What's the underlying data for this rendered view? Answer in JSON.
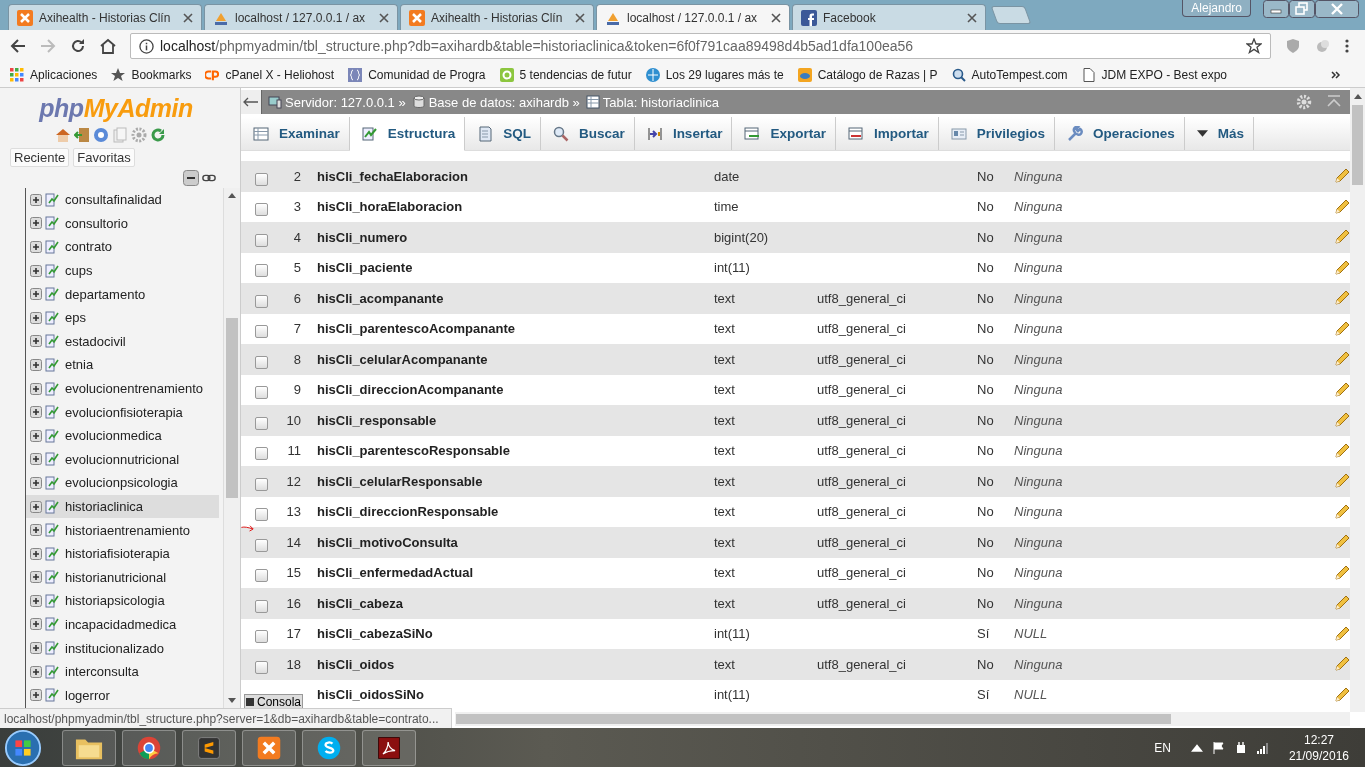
{
  "browser": {
    "tabs": [
      {
        "title": "Axihealth - Historias Clín",
        "kind": "xampp",
        "selected": false
      },
      {
        "title": "localhost / 127.0.0.1 / ax",
        "kind": "pma",
        "selected": false
      },
      {
        "title": "Axihealth - Historias Clín",
        "kind": "xampp",
        "selected": false
      },
      {
        "title": "localhost / 127.0.0.1 / ax",
        "kind": "pma",
        "selected": true
      },
      {
        "title": "Facebook",
        "kind": "facebook",
        "selected": false
      }
    ],
    "profile": "Alejandro",
    "address": {
      "host": "localhost",
      "path": "/phpmyadmin/tbl_structure.php?db=axihardb&table=historiaclinica&token=6f0f791caa89498d4b5ad1dfa100ea56"
    },
    "bookmarks": [
      {
        "label": "Aplicaciones",
        "kind": "apps"
      },
      {
        "label": "Bookmarks",
        "kind": "star"
      },
      {
        "label": "cPanel X - Heliohost",
        "kind": "cpanel"
      },
      {
        "label": "Comunidad de Progra",
        "kind": "braces"
      },
      {
        "label": "5 tendencias de futur",
        "kind": "green"
      },
      {
        "label": "Los 29 lugares más te",
        "kind": "globe"
      },
      {
        "label": "Catálogo de Razas | P",
        "kind": "orange"
      },
      {
        "label": "AutoTempest.com",
        "kind": "search"
      },
      {
        "label": "JDM EXPO - Best expo",
        "kind": "page"
      }
    ]
  },
  "sidebar": {
    "logo": {
      "prefix": "php",
      "name": "MyAdmin"
    },
    "buttons": [
      "Reciente",
      "Favoritas"
    ],
    "tables": [
      {
        "name": "consultafinalidad",
        "selected": false
      },
      {
        "name": "consultorio",
        "selected": false
      },
      {
        "name": "contrato",
        "selected": false
      },
      {
        "name": "cups",
        "selected": false
      },
      {
        "name": "departamento",
        "selected": false
      },
      {
        "name": "eps",
        "selected": false
      },
      {
        "name": "estadocivil",
        "selected": false
      },
      {
        "name": "etnia",
        "selected": false
      },
      {
        "name": "evolucionentrenamiento",
        "selected": false
      },
      {
        "name": "evolucionfisioterapia",
        "selected": false
      },
      {
        "name": "evolucionmedica",
        "selected": false
      },
      {
        "name": "evolucionnutricional",
        "selected": false
      },
      {
        "name": "evolucionpsicologia",
        "selected": false
      },
      {
        "name": "historiaclinica",
        "selected": true
      },
      {
        "name": "historiaentrenamiento",
        "selected": false
      },
      {
        "name": "historiafisioterapia",
        "selected": false
      },
      {
        "name": "historianutricional",
        "selected": false
      },
      {
        "name": "historiapsicologia",
        "selected": false
      },
      {
        "name": "incapacidadmedica",
        "selected": false
      },
      {
        "name": "institucionalizado",
        "selected": false
      },
      {
        "name": "interconsulta",
        "selected": false
      },
      {
        "name": "logerror",
        "selected": false
      }
    ]
  },
  "breadcrumb": [
    {
      "label": "Servidor: 127.0.0.1 »",
      "kind": "server"
    },
    {
      "label": "Base de datos: axihardb »",
      "kind": "database"
    },
    {
      "label": "Tabla: historiaclinica",
      "kind": "table"
    }
  ],
  "tabs": [
    {
      "label": "Examinar",
      "kind": "browse",
      "selected": false
    },
    {
      "label": "Estructura",
      "kind": "structure",
      "selected": true
    },
    {
      "label": "SQL",
      "kind": "sql",
      "selected": false
    },
    {
      "label": "Buscar",
      "kind": "search",
      "selected": false
    },
    {
      "label": "Insertar",
      "kind": "insert",
      "selected": false
    },
    {
      "label": "Exportar",
      "kind": "export",
      "selected": false
    },
    {
      "label": "Importar",
      "kind": "import",
      "selected": false
    },
    {
      "label": "Privilegios",
      "kind": "privileges",
      "selected": false
    },
    {
      "label": "Operaciones",
      "kind": "operations",
      "selected": false
    },
    {
      "label": "Más",
      "kind": "more",
      "selected": false
    }
  ],
  "structure_rows": [
    {
      "checked": false,
      "number": "2",
      "name": "hisCli_fechaElaboracion",
      "type": "date",
      "null": "No",
      "default": "Ninguna"
    },
    {
      "checked": false,
      "number": "3",
      "name": "hisCli_horaElaboracion",
      "type": "time",
      "null": "No",
      "default": "Ninguna"
    },
    {
      "checked": false,
      "number": "4",
      "name": "hisCli_numero",
      "type": "bigint(20)",
      "null": "No",
      "default": "Ninguna"
    },
    {
      "checked": false,
      "number": "5",
      "name": "hisCli_paciente",
      "type": "int(11)",
      "null": "No",
      "default": "Ninguna"
    },
    {
      "checked": false,
      "number": "6",
      "name": "hisCli_acompanante",
      "type": "text",
      "collation": "utf8_general_ci",
      "null": "No",
      "default": "Ninguna"
    },
    {
      "checked": false,
      "number": "7",
      "name": "hisCli_parentescoAcompanante",
      "type": "text",
      "collation": "utf8_general_ci",
      "null": "No",
      "default": "Ninguna"
    },
    {
      "checked": false,
      "number": "8",
      "name": "hisCli_celularAcompanante",
      "type": "text",
      "collation": "utf8_general_ci",
      "null": "No",
      "default": "Ninguna"
    },
    {
      "checked": false,
      "number": "9",
      "name": "hisCli_direccionAcompanante",
      "type": "text",
      "collation": "utf8_general_ci",
      "null": "No",
      "default": "Ninguna"
    },
    {
      "checked": false,
      "number": "10",
      "name": "hisCli_responsable",
      "type": "text",
      "collation": "utf8_general_ci",
      "null": "No",
      "default": "Ninguna"
    },
    {
      "checked": false,
      "number": "11",
      "name": "hisCli_parentescoResponsable",
      "type": "text",
      "collation": "utf8_general_ci",
      "null": "No",
      "default": "Ninguna"
    },
    {
      "checked": false,
      "number": "12",
      "name": "hisCli_celularResponsable",
      "type": "text",
      "collation": "utf8_general_ci",
      "null": "No",
      "default": "Ninguna"
    },
    {
      "checked": false,
      "number": "13",
      "name": "hisCli_direccionResponsable",
      "type": "text",
      "collation": "utf8_general_ci",
      "null": "No",
      "default": "Ninguna"
    },
    {
      "checked": false,
      "number": "14",
      "name": "hisCli_motivoConsulta",
      "type": "text",
      "collation": "utf8_general_ci",
      "null": "No",
      "default": "Ninguna"
    },
    {
      "checked": false,
      "number": "15",
      "name": "hisCli_enfermedadActual",
      "type": "text",
      "collation": "utf8_general_ci",
      "null": "No",
      "default": "Ninguna"
    },
    {
      "checked": false,
      "number": "16",
      "name": "hisCli_cabeza",
      "type": "text",
      "collation": "utf8_general_ci",
      "null": "No",
      "default": "Ninguna"
    },
    {
      "checked": false,
      "number": "17",
      "name": "hisCli_cabezaSiNo",
      "type": "int(11)",
      "null": "Sí",
      "default": "NULL"
    },
    {
      "checked": false,
      "number": "18",
      "name": "hisCli_oidos",
      "type": "text",
      "collation": "utf8_general_ci",
      "null": "No",
      "default": "Ninguna"
    },
    {
      "name": "hisCli_oidosSiNo",
      "type": "int(11)",
      "null": "Sí",
      "default": "NULL"
    }
  ],
  "console_button": "Consola",
  "status_url": "localhost/phpmyadmin/tbl_structure.php?server=1&db=axihardb&table=contrato...",
  "taskbar": {
    "language": "EN",
    "time": "12:27",
    "date": "21/09/2016"
  }
}
